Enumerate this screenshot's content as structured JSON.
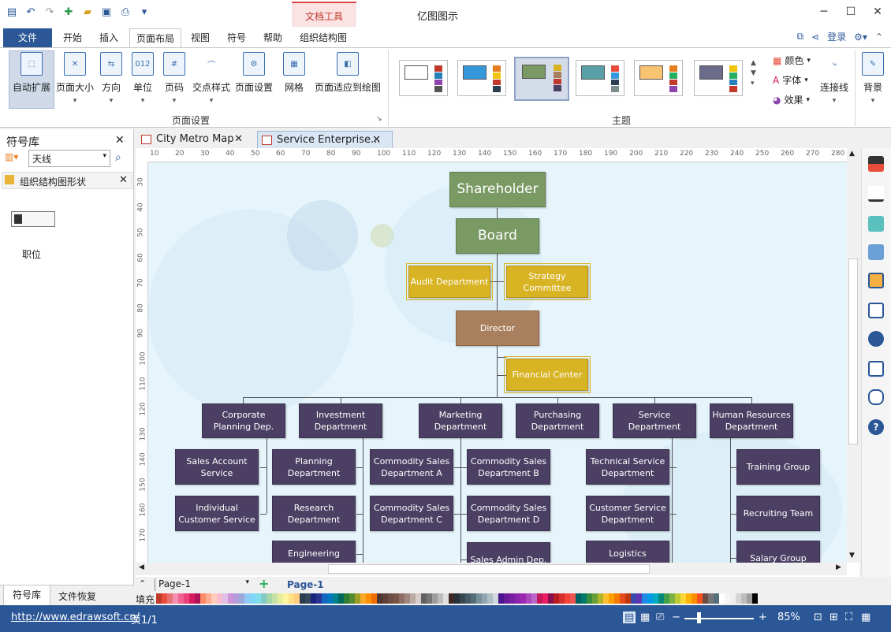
{
  "app": {
    "title": "亿图图示",
    "context_tab_group": "文档工具"
  },
  "window_controls": [
    "─",
    "☐",
    "✕"
  ],
  "ribbon_tabs": [
    "文件",
    "开始",
    "插入",
    "页面布局",
    "视图",
    "符号",
    "帮助",
    "组织结构图"
  ],
  "header_right": {
    "login": "登录"
  },
  "ribbon": {
    "page_setup_buttons": [
      "自动扩展",
      "页面大小",
      "方向",
      "单位",
      "页码",
      "交点样式",
      "页面设置",
      "网格",
      "页面适应到绘图"
    ],
    "page_setup_group": "页面设置",
    "theme_group": "主题",
    "theme_options": [
      "颜色",
      "字体",
      "效果"
    ],
    "connector": "连接线",
    "background": "背景"
  },
  "left_panel": {
    "title": "符号库",
    "search_value": "天线",
    "library_name": "组织结构图形状",
    "shape_label": "职位",
    "bottom_tabs": [
      "符号库",
      "文件恢复"
    ]
  },
  "doc_tabs": [
    "City Metro Map",
    "Service Enterprise..."
  ],
  "ruler_h": [
    "10",
    "20",
    "30",
    "40",
    "50",
    "60",
    "70",
    "80",
    "90",
    "100",
    "110",
    "120",
    "130",
    "140",
    "150",
    "160",
    "170",
    "180",
    "190",
    "200",
    "210",
    "220",
    "230",
    "240",
    "250",
    "260",
    "270",
    "280"
  ],
  "ruler_v": [
    "30",
    "40",
    "50",
    "60",
    "70",
    "80",
    "90",
    "100",
    "110",
    "120",
    "130",
    "140",
    "150",
    "160",
    "170"
  ],
  "org": {
    "shareholder": "Shareholder",
    "board": "Board",
    "audit": "Audit Department",
    "strategy": "Strategy Committee",
    "director": "Director",
    "financial": "Financial Center",
    "depts": [
      "Corporate Planning Dep.",
      "Investment Department",
      "Marketing Department",
      "Purchasing Department",
      "Service Department",
      "Human Resources Department"
    ],
    "corp_children": [
      "Sales Account Service",
      "Individual Customer Service"
    ],
    "invest_children": [
      "Planning Department",
      "Research Department",
      "Engineering"
    ],
    "market_left": [
      "Commodity Sales Department A",
      "Commodity Sales Department C"
    ],
    "market_right": [
      "Commodity Sales Department B",
      "Commodity Sales Department D",
      "Sales Admin Dep."
    ],
    "service_children": [
      "Technical Service Department",
      "Customer Service Department",
      "Logistics"
    ],
    "hr_children": [
      "Training Group",
      "Recruiting Team",
      "Salary Group"
    ]
  },
  "pages_bar": {
    "page_select": "Page-1",
    "active_page": "Page-1",
    "fill_label": "填充"
  },
  "status": {
    "url": "http://www.edrawsoft.cn/",
    "page_count": "页1/1",
    "zoom": "85%"
  },
  "colors": {
    "accent": "#2b5797",
    "green": "#7a9a64",
    "gold": "#d8b323",
    "brown": "#a9805e",
    "purple": "#4b4063"
  }
}
